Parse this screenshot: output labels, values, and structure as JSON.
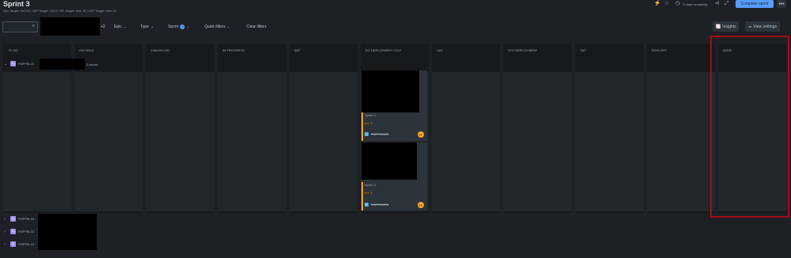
{
  "header": {
    "title": "Sprint 3",
    "subtitle": "Dev Target: Oct 24 | QAT Target: Oct 9 | RC Target: Nov 10 | UAT Target: Nov 13",
    "days_remaining": "0 days remaining",
    "complete_sprint_label": "Complete sprint",
    "more_label": "•••",
    "icons": [
      "lightning-icon",
      "star-icon",
      "clock-icon",
      "share-icon",
      "fullscreen-icon"
    ]
  },
  "filters": {
    "search_placeholder": "",
    "avatar_more": "+2",
    "epic_label": "Epic",
    "type_label": "Type",
    "sprint_label": "Sprint",
    "sprint_count": "1",
    "quick_filters_label": "Quick filters",
    "clear_filters_label": "Clear filters",
    "insights_label": "Insights",
    "view_settings_label": "View settings"
  },
  "columns": [
    "TO DO",
    "ON HOLD",
    "CANCELLED",
    "IN PROGRESS",
    "QAT",
    "RC DEPLOYMENT 17/17",
    "UAT",
    "STG DEPLOYMENT",
    "SAT",
    "SIGN OFF",
    "DONE"
  ],
  "swimlanes": [
    {
      "key": "FMPFM-21",
      "count": "2 issues",
      "expanded": true
    },
    {
      "key": "FMPFM-15",
      "expanded": false
    },
    {
      "key": "FMPFM-22",
      "expanded": false
    },
    {
      "key": "FMPFM-10",
      "expanded": false
    }
  ],
  "cards": [
    {
      "sprint": "Sprint 3",
      "priority": "▪▪▪ ≡",
      "key": "FMPFM-283",
      "assignee": "FF"
    },
    {
      "sprint": "Sprint 3",
      "priority": "▪▪▪ ≡",
      "key": "FMPFM-276",
      "assignee": "FF"
    }
  ],
  "colors": {
    "accent": "#579dff",
    "epic": "#9f8fef",
    "priority": "#f5a623",
    "highlight": "#a00d18"
  }
}
